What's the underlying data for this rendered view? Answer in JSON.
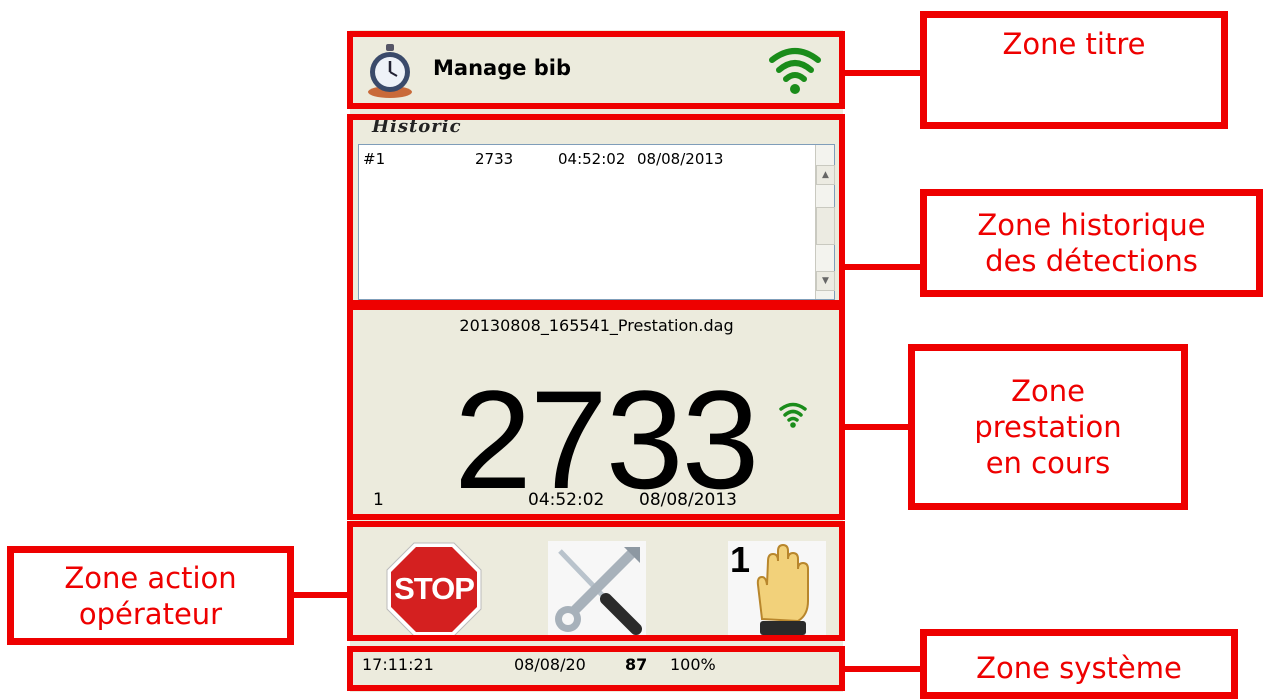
{
  "app": {
    "title": "Manage bib"
  },
  "historic": {
    "label": "Historic",
    "rows": [
      {
        "index": "#1",
        "bib": "2733",
        "time": "04:52:02",
        "date": "08/08/2013"
      }
    ]
  },
  "prestation": {
    "filename": "20130808_165541_Prestation.dag",
    "bib": "2733",
    "count": "1",
    "time": "04:52:02",
    "date": "08/08/2013"
  },
  "actions": {
    "stop_label": "STOP",
    "manual_count": "1"
  },
  "status_bar": {
    "time": "17:11:21",
    "date": "08/08/20",
    "value": "87",
    "percent": "100%"
  },
  "annotations": {
    "title_zone": "Zone titre",
    "history_zone": "Zone historique des détections",
    "prestation_zone": "Zone prestation en cours",
    "action_zone": "Zone action opérateur",
    "system_zone": "Zone système"
  },
  "colors": {
    "annotation_red": "#ee0000",
    "device_bg": "#ecebdd",
    "wifi_green": "#1a8c1a",
    "stop_red": "#d42020"
  },
  "icons": {
    "app_icon": "stopwatch-icon",
    "wifi_title": "wifi-signal-icon",
    "wifi_small": "wifi-signal-icon",
    "stop": "stop-sign-icon",
    "settings": "tools-icon",
    "manual": "raised-hand-icon"
  }
}
